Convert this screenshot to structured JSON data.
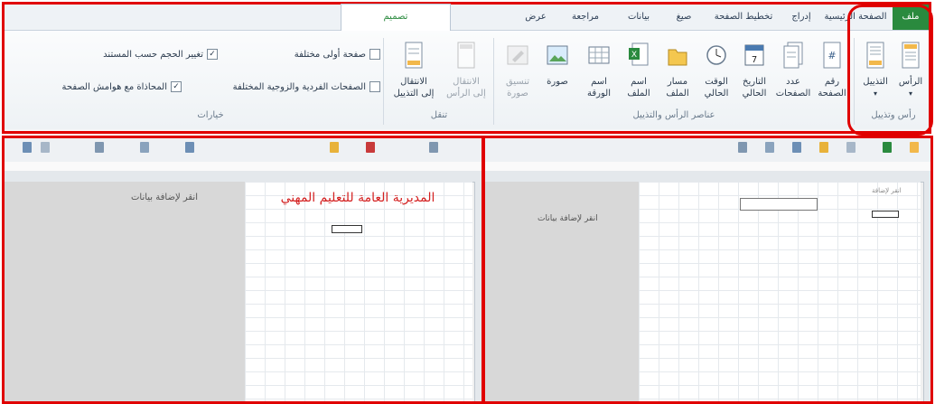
{
  "tabs": [
    {
      "label": "ملف",
      "active": false,
      "file": true
    },
    {
      "label": "الصفحة الرئيسية"
    },
    {
      "label": "إدراج"
    },
    {
      "label": "تخطيط الصفحة"
    },
    {
      "label": "صيغ"
    },
    {
      "label": "بيانات"
    },
    {
      "label": "مراجعة"
    },
    {
      "label": "عرض"
    },
    {
      "label": "تصميم",
      "active": true
    }
  ],
  "groups": {
    "header_footer": {
      "label": "رأس وتذييل",
      "header_button": "الرأس",
      "footer_button": "التذييل"
    },
    "elements": {
      "label": "عناصر الرأس والتذييل",
      "page_number_1": "رقم",
      "page_number_2": "الصفحة",
      "page_count_1": "عدد",
      "page_count_2": "الصفحات",
      "current_date_1": "التاريخ",
      "current_date_2": "الحالي",
      "current_time_1": "الوقت",
      "current_time_2": "الحالي",
      "file_path_1": "مسار",
      "file_path_2": "الملف",
      "file_name_1": "اسم",
      "file_name_2": "الملف",
      "sheet_name_1": "اسم",
      "sheet_name_2": "الورقة",
      "picture": "صورة",
      "format_picture_1": "تنسيق",
      "format_picture_2": "صورة"
    },
    "navigation": {
      "label": "تنقل",
      "go_header_1": "الانتقال",
      "go_header_2": "إلى الرأس",
      "go_footer_1": "الانتقال",
      "go_footer_2": "إلى التذييل"
    },
    "options": {
      "label": "خيارات",
      "different_first": "صفحة أولى مختلفة",
      "different_odd_even": "الصفحات الفردية والزوجية المختلفة",
      "scale_with_doc": "تغيير الحجم حسب المستند",
      "align_margins": "المحاذاة مع هوامش الصفحة"
    }
  },
  "left_panel": {
    "sheet_heading": "المديرية العامة للتعليم المهني",
    "add_data_hint": "انقر لإضافة بيانات"
  },
  "right_panel": {
    "add_data_hint": "انقر لإضافة بيانات",
    "header_hint": "انقر لإضافة"
  },
  "colors": {
    "annotation_red": "#e00000",
    "file_tab_green": "#2a8a3e",
    "heading_red": "#d42020"
  }
}
